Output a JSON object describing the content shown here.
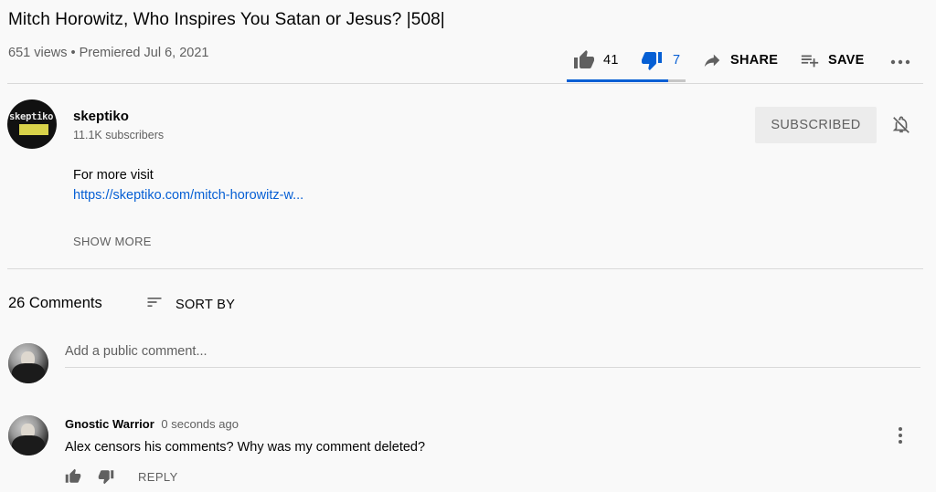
{
  "video": {
    "title": "Mitch Horowitz, Who Inspires You Satan or Jesus? |508|",
    "meta": "651 views • Premiered Jul 6, 2021"
  },
  "actions": {
    "like_count": "41",
    "dislike_count": "7",
    "like_ratio": 0.854,
    "share_label": "SHARE",
    "save_label": "SAVE"
  },
  "channel": {
    "name": "skeptiko",
    "subscribers": "11.1K subscribers",
    "avatar_text": "skeptiko",
    "subscribe_label": "SUBSCRIBED"
  },
  "description": {
    "text": "For more visit",
    "link": "https://skeptiko.com/mitch-horowitz-w...",
    "show_more": "SHOW MORE"
  },
  "comments": {
    "count_label": "26 Comments",
    "sort_label": "SORT BY",
    "add_placeholder": "Add a public comment...",
    "items": [
      {
        "author": "Gnostic Warrior",
        "time": "0 seconds ago",
        "text": "Alex censors his comments? Why was my comment deleted?",
        "reply_label": "REPLY"
      }
    ]
  },
  "colors": {
    "accent": "#065fd4",
    "text": "#030303",
    "secondary": "#606060",
    "background": "#f9f9f9"
  }
}
